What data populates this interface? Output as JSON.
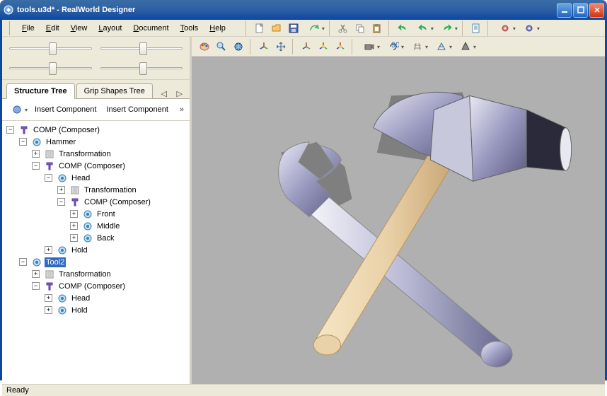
{
  "title": "tools.u3d* - RealWorld Designer",
  "menus": {
    "file": "File",
    "edit": "Edit",
    "view": "View",
    "layout": "Layout",
    "document": "Document",
    "tools": "Tools",
    "help": "Help"
  },
  "sliders": [
    50,
    50,
    50,
    50
  ],
  "tabs": {
    "structure": "Structure Tree",
    "grip": "Grip Shapes Tree"
  },
  "sub_toolbar": {
    "insert1": "Insert Component",
    "insert2": "Insert Component"
  },
  "tree": [
    {
      "d": 0,
      "exp": "-",
      "icon": "comp",
      "label": "COMP (Composer)"
    },
    {
      "d": 1,
      "exp": "-",
      "icon": "obj",
      "label": "Hammer"
    },
    {
      "d": 2,
      "exp": "+",
      "icon": "xform",
      "label": "Transformation"
    },
    {
      "d": 2,
      "exp": "-",
      "icon": "comp",
      "label": "COMP (Composer)"
    },
    {
      "d": 3,
      "exp": "-",
      "icon": "obj",
      "label": "Head"
    },
    {
      "d": 4,
      "exp": "+",
      "icon": "xform",
      "label": "Transformation"
    },
    {
      "d": 4,
      "exp": "-",
      "icon": "comp",
      "label": "COMP (Composer)"
    },
    {
      "d": 5,
      "exp": "+",
      "icon": "obj",
      "label": "Front"
    },
    {
      "d": 5,
      "exp": "+",
      "icon": "obj",
      "label": "Middle"
    },
    {
      "d": 5,
      "exp": "+",
      "icon": "obj",
      "label": "Back"
    },
    {
      "d": 3,
      "exp": "+",
      "icon": "obj",
      "label": "Hold"
    },
    {
      "d": 1,
      "exp": "-",
      "icon": "obj",
      "label": "Tool2",
      "sel": true
    },
    {
      "d": 2,
      "exp": "+",
      "icon": "xform",
      "label": "Transformation"
    },
    {
      "d": 2,
      "exp": "-",
      "icon": "comp",
      "label": "COMP (Composer)"
    },
    {
      "d": 3,
      "exp": "+",
      "icon": "obj",
      "label": "Head"
    },
    {
      "d": 3,
      "exp": "+",
      "icon": "obj",
      "label": "Hold"
    }
  ],
  "status": "Ready",
  "colors": {
    "titlebar": "#0d47a1",
    "panel": "#ece9d8",
    "viewport": "#b0b0b0",
    "selection": "#316ac5"
  }
}
